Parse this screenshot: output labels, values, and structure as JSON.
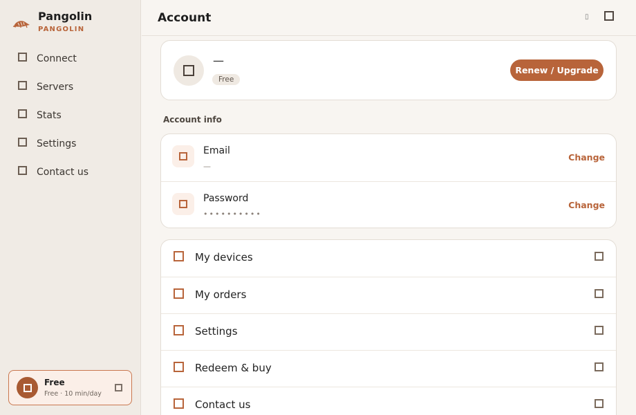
{
  "app": {
    "name": "Pangolin",
    "subtitle": "PANGOLIN",
    "accent_color": "#b8643a"
  },
  "sidebar": {
    "items": [
      {
        "label": "Connect",
        "icon": "connect-icon"
      },
      {
        "label": "Servers",
        "icon": "servers-icon"
      },
      {
        "label": "Stats",
        "icon": "stats-icon"
      },
      {
        "label": "Settings",
        "icon": "settings-icon"
      },
      {
        "label": "Contact us",
        "icon": "contact-icon"
      }
    ],
    "plan": {
      "title": "Free",
      "subtitle": "Free · 10 min/day"
    }
  },
  "header": {
    "title": "Account",
    "small_glyph": "▯"
  },
  "profile": {
    "name": "—",
    "badge": "Free",
    "upgrade_label": "Renew / Upgrade"
  },
  "account_info": {
    "section_label": "Account info",
    "rows": [
      {
        "label": "Email",
        "value": "—",
        "action": "Change"
      },
      {
        "label": "Password",
        "value": "••••••••••",
        "action": "Change"
      }
    ]
  },
  "menu": {
    "items": [
      {
        "label": "My devices"
      },
      {
        "label": "My orders"
      },
      {
        "label": "Settings"
      },
      {
        "label": "Redeem & buy"
      },
      {
        "label": "Contact us"
      }
    ]
  }
}
